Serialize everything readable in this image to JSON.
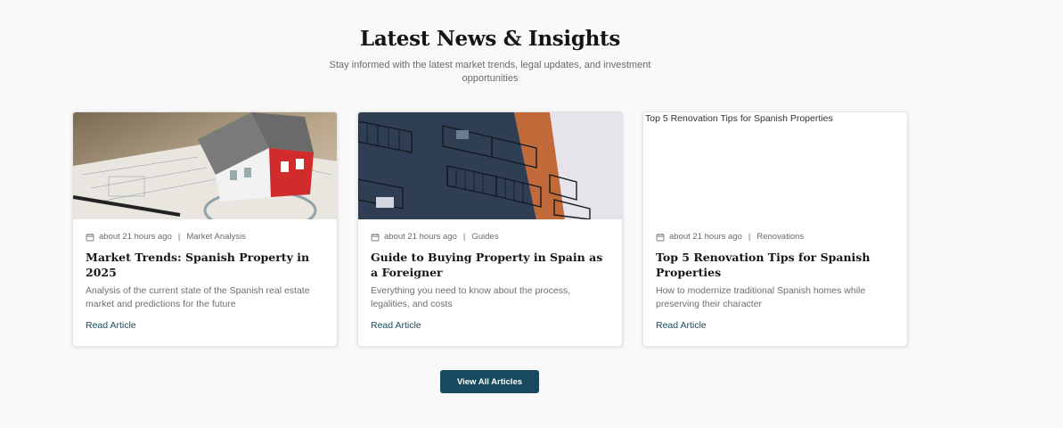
{
  "header": {
    "title": "Latest News & Insights",
    "subtitle": "Stay informed with the latest market trends, legal updates, and investment opportunities"
  },
  "cards": [
    {
      "time": "about 21 hours ago",
      "category": "Market Analysis",
      "title": "Market Trends: Spanish Property in 2025",
      "description": "Analysis of the current state of the Spanish real estate market and predictions for the future",
      "link": "Read Article",
      "image": "house-model-on-blueprints"
    },
    {
      "time": "about 21 hours ago",
      "category": "Guides",
      "title": "Guide to Buying Property in Spain as a Foreigner",
      "description": "Everything you need to know about the process, legalities, and costs",
      "link": "Read Article",
      "image": "apartment-building-balconies"
    },
    {
      "time": "about 21 hours ago",
      "category": "Renovations",
      "title": "Top 5 Renovation Tips for Spanish Properties",
      "description": "How to modernize traditional Spanish homes while preserving their character",
      "link": "Read Article",
      "image_alt": "Top 5 Renovation Tips for Spanish Properties"
    }
  ],
  "view_all_label": "View All Articles",
  "colors": {
    "accent": "#174a5e",
    "link": "#1d4a5e"
  }
}
